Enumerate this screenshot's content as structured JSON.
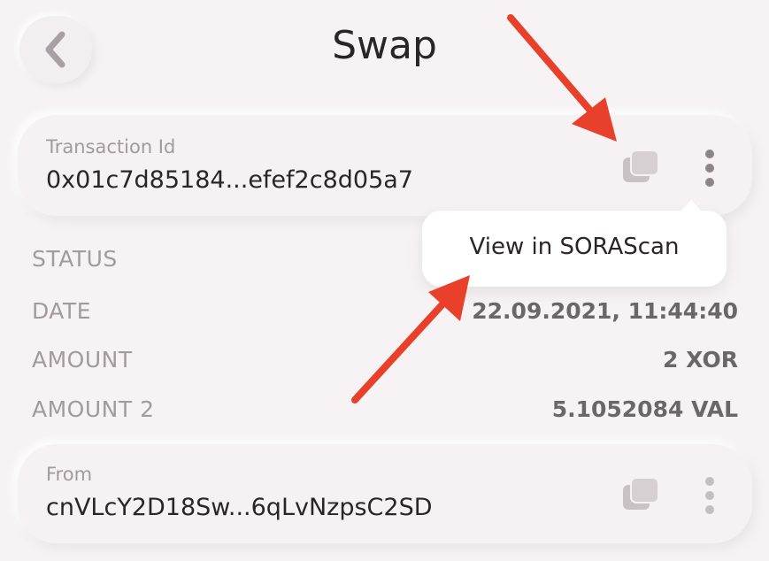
{
  "header": {
    "title": "Swap"
  },
  "transaction": {
    "label": "Transaction Id",
    "value": "0x01c7d85184...efef2c8d05a7"
  },
  "popup": {
    "item_label": "View in SORAScan"
  },
  "details": [
    {
      "label": "STATUS",
      "value": ""
    },
    {
      "label": "DATE",
      "value": "22.09.2021, 11:44:40"
    },
    {
      "label": "AMOUNT",
      "value": "2 XOR"
    },
    {
      "label": "AMOUNT 2",
      "value": "5.1052084 VAL"
    }
  ],
  "from": {
    "label": "From",
    "value": "cnVLcY2D18Sw...6qLvNzpsC2SD"
  },
  "colors": {
    "background": "#f7f3f4",
    "annotation_arrow": "#e8402a",
    "label_gray": "#a39a9e",
    "value_gray": "#6d6669"
  },
  "icons": {
    "back": "chevron-left-icon",
    "copy": "copy-icon",
    "menu": "more-vertical-icon"
  }
}
